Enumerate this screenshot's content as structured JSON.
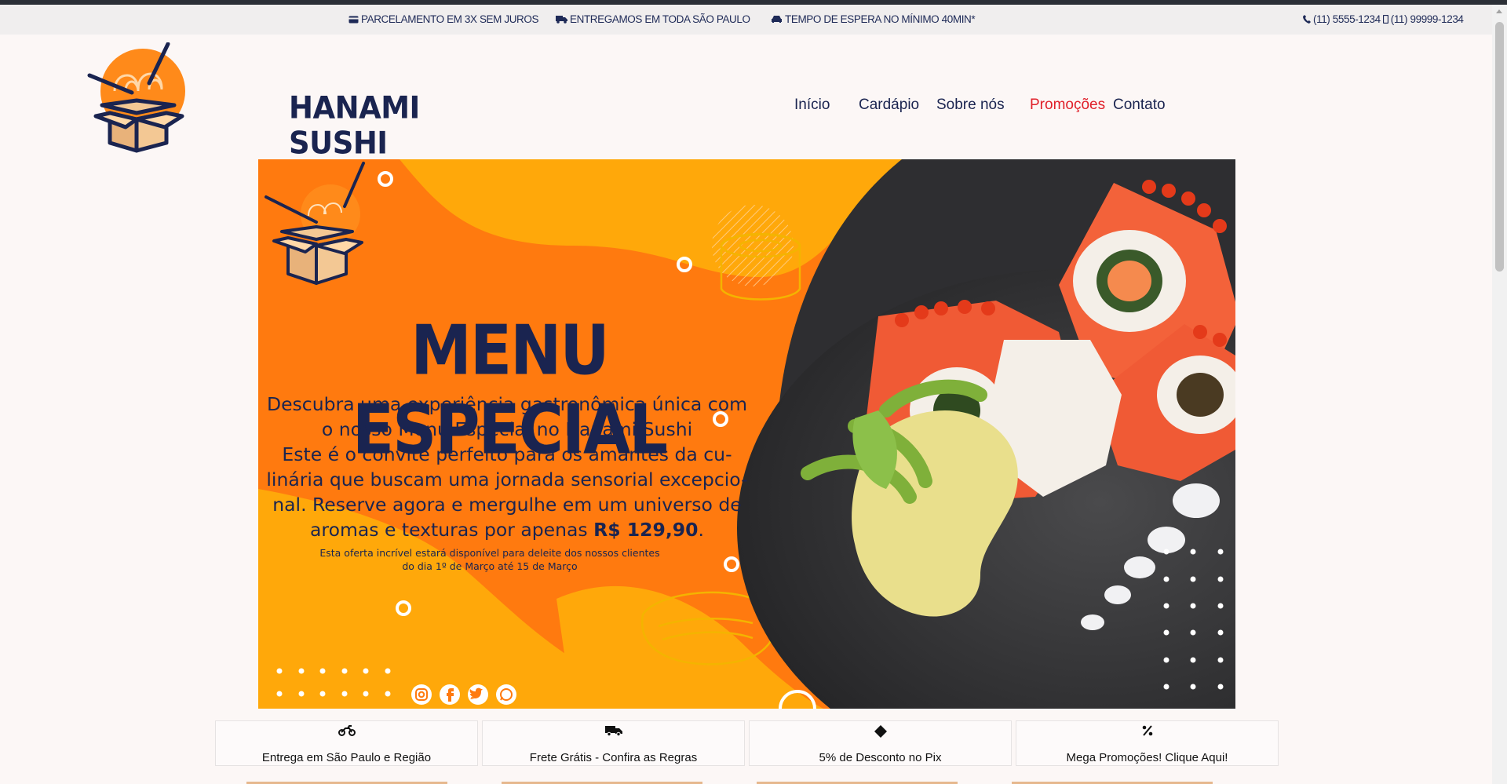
{
  "topbar": {
    "installments": "PARCELAMENTO EM 3X SEM JUROS",
    "delivery": "ENTREGAMOS EM TODA SÃO PAULO",
    "wait_time": "TEMPO DE ESPERA NO MÍNIMO 40MIN*",
    "phone_1": "(11) 5555-1234",
    "phone_2": "(11) 99999-1234"
  },
  "brand": {
    "name": "HANAMI SUSHI"
  },
  "nav": {
    "items": [
      {
        "label": "Início"
      },
      {
        "label": "Cardápio"
      },
      {
        "label": "Sobre nós"
      },
      {
        "label": "Promoções"
      },
      {
        "label": "Contato"
      }
    ],
    "active_color": "#e0202a"
  },
  "banner": {
    "title": "MENU ESPECIAL",
    "description_1": "Descubra uma experiência gastronômica única com",
    "description_2": "o nosso Menu Especial no Hanami Sushi",
    "description_3": "Este é o convite perfeito para os amantes da cu-",
    "description_4": "linária que buscam uma jornada sensorial excepcio-",
    "description_5": "nal. Reserve agora e mergulhe em um universo de",
    "description_6": "aromas e texturas por apenas",
    "price": "R$ 129,90",
    "fine_print_1": "Esta oferta incrível estará disponível para deleite dos nossos clientes",
    "fine_print_2": "do dia 1º de Março até 15 de Março",
    "social_icons": [
      "instagram-icon",
      "facebook-icon",
      "twitter-icon",
      "whatsapp-icon"
    ],
    "colors": {
      "orange": "#ff7a0f",
      "yellow": "#ffa80a",
      "navy": "#1a2450"
    }
  },
  "features": [
    {
      "icon": "motorcycle-icon",
      "label": "Entrega em São Paulo e Região"
    },
    {
      "icon": "truck-icon",
      "label": "Frete Grátis - Confira as Regras"
    },
    {
      "icon": "pix-icon",
      "label": "5% de Desconto no Pix"
    },
    {
      "icon": "percent-icon",
      "label": "Mega Promoções! Clique Aqui!"
    }
  ]
}
